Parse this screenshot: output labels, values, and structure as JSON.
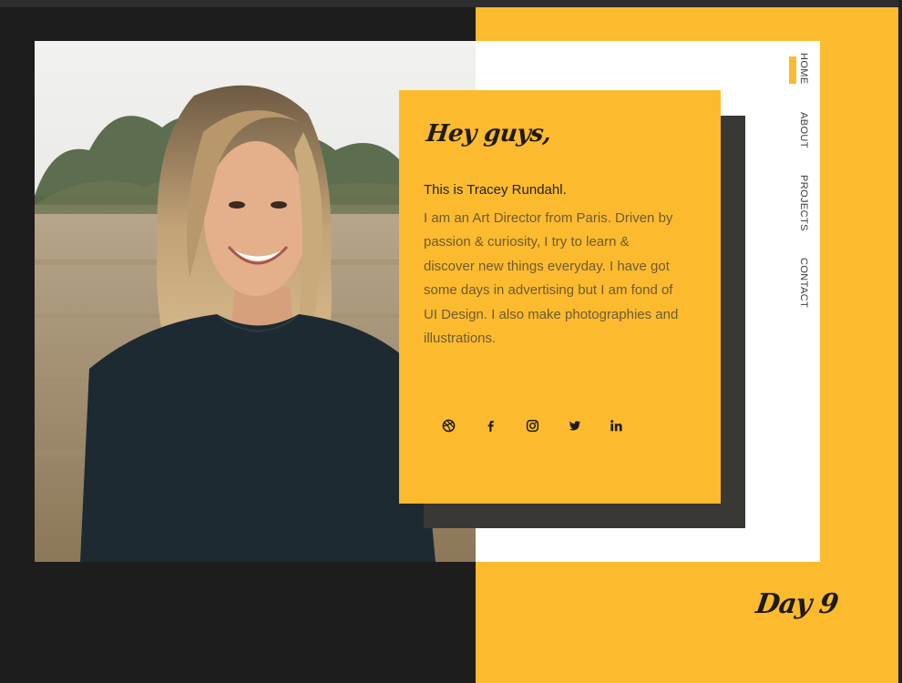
{
  "card": {
    "greeting": "Hey guys,",
    "intro": "This is Tracey Rundahl.",
    "bio": "I am an Art Director from Paris. Driven by passion & curiosity, I try to learn & discover new things everyday. I have got some days in advertising but I am fond of UI Design. I also make photographies and illustrations."
  },
  "socials": [
    {
      "icon": "dribbble-icon",
      "label": "Dribbble"
    },
    {
      "icon": "facebook-icon",
      "label": "f"
    },
    {
      "icon": "instagram-icon",
      "label": "Instagram"
    },
    {
      "icon": "twitter-icon",
      "label": "Twitter"
    },
    {
      "icon": "linkedin-icon",
      "label": "in"
    }
  ],
  "nav": {
    "home": "HOME",
    "about": "ABOUT",
    "projects": "PROJECTS",
    "contact": "CONTACT"
  },
  "footer": {
    "day": "Day 9"
  },
  "colors": {
    "accent": "#fcbb2f",
    "dark": "#1d1d1d",
    "shadow": "#3a3835"
  }
}
